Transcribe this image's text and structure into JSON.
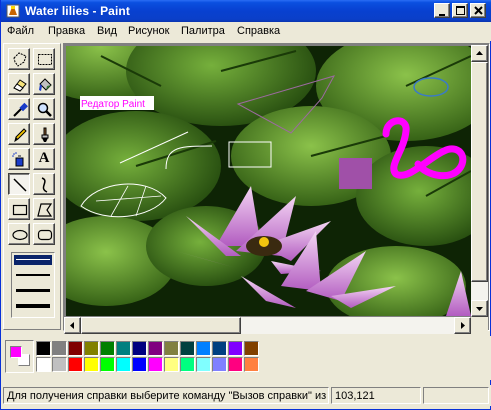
{
  "window": {
    "title": "Water lilies - Paint"
  },
  "menu": [
    {
      "label": "Файл"
    },
    {
      "label": "Правка"
    },
    {
      "label": "Вид"
    },
    {
      "label": "Рисунок"
    },
    {
      "label": "Палитра"
    },
    {
      "label": "Справка"
    }
  ],
  "tools": [
    {
      "name": "free-form-select-tool",
      "icon": "free-select-icon"
    },
    {
      "name": "select-tool",
      "icon": "rect-select-icon"
    },
    {
      "name": "eraser-tool",
      "icon": "eraser-icon"
    },
    {
      "name": "fill-tool",
      "icon": "fill-bucket-icon"
    },
    {
      "name": "pick-color-tool",
      "icon": "eyedropper-icon"
    },
    {
      "name": "magnifier-tool",
      "icon": "magnifier-icon"
    },
    {
      "name": "pencil-tool",
      "icon": "pencil-icon"
    },
    {
      "name": "brush-tool",
      "icon": "brush-icon"
    },
    {
      "name": "airbrush-tool",
      "icon": "airbrush-icon"
    },
    {
      "name": "text-tool",
      "icon": "text-icon",
      "glyph": "A"
    },
    {
      "name": "line-tool",
      "icon": "line-icon",
      "active": true
    },
    {
      "name": "curve-tool",
      "icon": "curve-icon"
    },
    {
      "name": "rectangle-tool",
      "icon": "rectangle-icon"
    },
    {
      "name": "polygon-tool",
      "icon": "polygon-icon"
    },
    {
      "name": "ellipse-tool",
      "icon": "ellipse-icon"
    },
    {
      "name": "rounded-rectangle-tool",
      "icon": "rounded-rect-icon"
    }
  ],
  "line_widths": [
    "1",
    "2",
    "3",
    "4"
  ],
  "canvas": {
    "text_label": "Редатор Paint",
    "text_color": "#ff00ff"
  },
  "current_colors": {
    "foreground": "#ff00ff",
    "background": "#ffffff"
  },
  "palette": {
    "top_row": [
      "#000000",
      "#808080",
      "#800000",
      "#808000",
      "#008000",
      "#008080",
      "#000080",
      "#800080",
      "#808040",
      "#004040",
      "#0080ff",
      "#004080",
      "#8000ff",
      "#804000"
    ],
    "bottom_row": [
      "#ffffff",
      "#c0c0c0",
      "#ff0000",
      "#ffff00",
      "#00ff00",
      "#00ffff",
      "#0000ff",
      "#ff00ff",
      "#ffff80",
      "#00ff80",
      "#80ffff",
      "#8080ff",
      "#ff0080",
      "#ff8040"
    ]
  },
  "status": {
    "help": "Для получения справки выберите команду \"Вызов справки\" из",
    "coords": "103,121"
  }
}
